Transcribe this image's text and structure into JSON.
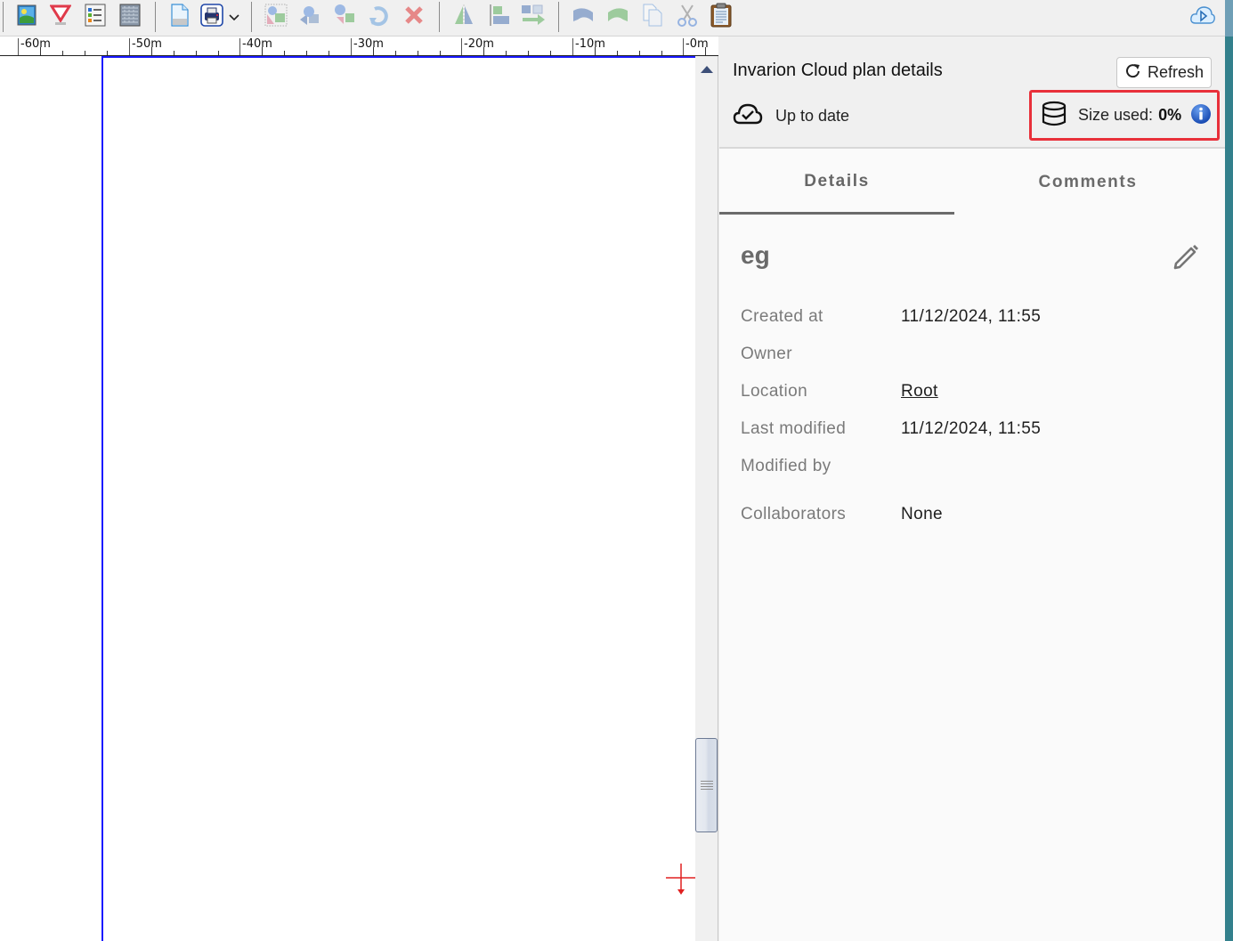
{
  "toolbar": {
    "groups": [
      [
        {
          "name": "image-icon",
          "label": "Insert image"
        },
        {
          "name": "yield-sign-icon",
          "label": "Symbol"
        },
        {
          "name": "legend-list-icon",
          "label": "Legend"
        },
        {
          "name": "hatch-pattern-icon",
          "label": "Pattern"
        }
      ],
      [
        {
          "name": "new-page-icon",
          "label": "Page"
        },
        {
          "name": "print-icon",
          "label": "Print"
        },
        {
          "name": "chevron-down-icon",
          "label": "More"
        }
      ],
      [
        {
          "name": "select-shapes-icon",
          "label": "Select"
        },
        {
          "name": "bring-front-icon",
          "label": "Bring to front"
        },
        {
          "name": "send-back-icon",
          "label": "Send to back"
        },
        {
          "name": "rotate-icon",
          "label": "Rotate"
        },
        {
          "name": "delete-icon",
          "label": "Delete"
        }
      ],
      [
        {
          "name": "mirror-icon",
          "label": "Mirror"
        },
        {
          "name": "align-icon",
          "label": "Align"
        },
        {
          "name": "distribute-icon",
          "label": "Distribute"
        }
      ],
      [
        {
          "name": "undo-icon",
          "label": "Undo"
        },
        {
          "name": "redo-icon",
          "label": "Redo"
        },
        {
          "name": "copy-icon",
          "label": "Copy"
        },
        {
          "name": "cut-icon",
          "label": "Cut"
        },
        {
          "name": "paste-icon",
          "label": "Paste"
        }
      ]
    ],
    "cloud_icon": "cloud-play-icon"
  },
  "ruler": {
    "unit": "m",
    "labels": [
      "-60m",
      "-50m",
      "-40m",
      "-30m",
      "-20m",
      "-10m",
      "-0m"
    ]
  },
  "panel": {
    "title": "Invarion Cloud plan details",
    "refresh_label": "Refresh",
    "status": "Up to date",
    "size_used_label": "Size used:",
    "size_used_value": "0%",
    "size_used_percent": 0,
    "highlight_color": "#e8303a",
    "tabs": [
      {
        "label": "Details",
        "active": true
      },
      {
        "label": "Comments",
        "active": false
      }
    ],
    "plan_name": "eg",
    "details": [
      {
        "key": "Created at",
        "value": "11/12/2024, 11:55"
      },
      {
        "key": "Owner",
        "value": ""
      },
      {
        "key": "Location",
        "value": "Root",
        "link": true
      },
      {
        "key": "Last modified",
        "value": "11/12/2024, 11:55"
      },
      {
        "key": "Modified by",
        "value": ""
      },
      {
        "key": "Collaborators",
        "value": "None"
      }
    ]
  }
}
